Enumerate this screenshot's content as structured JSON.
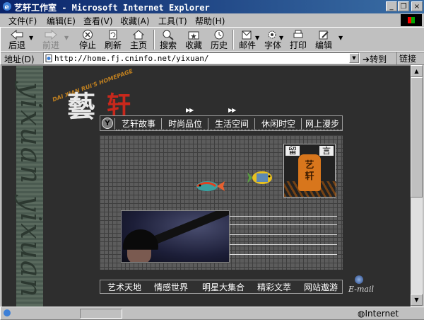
{
  "window": {
    "title": "艺轩工作室 - Microsoft Internet Explorer",
    "minimize": "_",
    "restore": "❐",
    "close": "×"
  },
  "menu": [
    "文件(F)",
    "编辑(E)",
    "查看(V)",
    "收藏(A)",
    "工具(T)",
    "帮助(H)"
  ],
  "toolbar": {
    "back": "后退",
    "forward": "前进",
    "stop": "停止",
    "refresh": "刷新",
    "home": "主页",
    "search": "搜索",
    "favorites": "收藏",
    "history": "历史",
    "mail": "邮件",
    "font": "字体",
    "print": "打印",
    "edit": "编辑"
  },
  "address": {
    "label": "地址(D)",
    "url": "http://home.fj.cninfo.net/yixuan/",
    "go": "转到",
    "links": "链接"
  },
  "page": {
    "side_text": "yixuan yixuan",
    "arc_text": "DAI XIAN RUI'S HOMEPAGE",
    "logo_char1": "藝",
    "logo_char2": "轩",
    "top_nav_badge": "Y",
    "top_nav": [
      "艺轩故事",
      "时尚品位",
      "生活空间",
      "休闲时空",
      "网上漫步"
    ],
    "badge": {
      "left_corner": "留",
      "right_corner": "言",
      "lantern_top": "艺",
      "lantern_bottom": "轩"
    },
    "bottom_nav": [
      "艺术天地",
      "情感世界",
      "明星大集合",
      "精彩文萃",
      "网站遨游"
    ],
    "email_label": "E-mail"
  },
  "status": {
    "zone": "Internet"
  },
  "colors": {
    "titlebar": "#0a246a",
    "chrome": "#c0c0c0",
    "page_bg": "#2e2e2e",
    "logo_red": "#c8281c"
  }
}
